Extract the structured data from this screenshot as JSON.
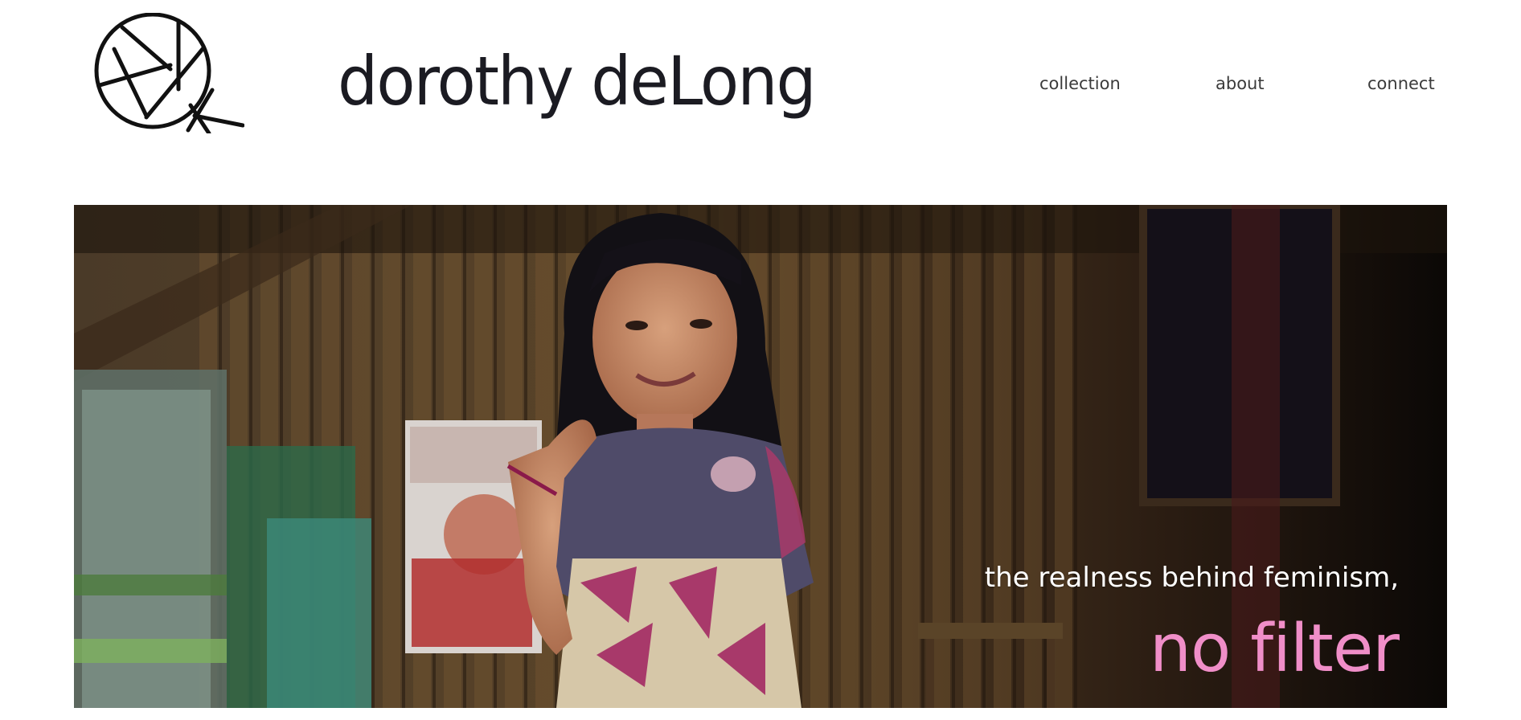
{
  "header": {
    "logo": {
      "icon": "camera-aperture-venus-icon",
      "color": "#111111"
    },
    "site_name": "dorothy deLong"
  },
  "nav": {
    "items": [
      {
        "label": "collection"
      },
      {
        "label": "about"
      },
      {
        "label": "connect"
      }
    ]
  },
  "hero": {
    "image": "smiling-girl-photo",
    "tagline": "the realness behind feminism,",
    "tagline_emphasis": "no filter",
    "tagline_color": "#ffffff",
    "emphasis_color": "#f08ec8"
  }
}
